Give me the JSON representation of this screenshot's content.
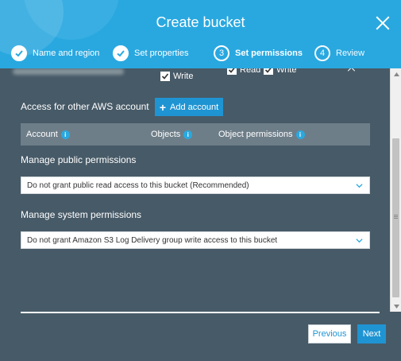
{
  "dialog": {
    "title": "Create bucket"
  },
  "steps": [
    {
      "number": "",
      "label": "Name and region",
      "state": "done"
    },
    {
      "number": "",
      "label": "Set properties",
      "state": "done"
    },
    {
      "number": "3",
      "label": "Set permissions",
      "state": "active"
    },
    {
      "number": "4",
      "label": "Review",
      "state": "future"
    }
  ],
  "permissions_row": {
    "write_label": "Write",
    "read_label": "Read",
    "write_label_2": "Write"
  },
  "other_account": {
    "label": "Access for other AWS account",
    "add_button_label": "Add account"
  },
  "table": {
    "columns": [
      "Account",
      "Objects",
      "Object permissions"
    ]
  },
  "public_permissions": {
    "label": "Manage public permissions",
    "selected": "Do not grant public read access to this bucket (Recommended)"
  },
  "system_permissions": {
    "label": "Manage system permissions",
    "selected": "Do not grant Amazon S3 Log Delivery group write access to this bucket"
  },
  "footer": {
    "previous_label": "Previous",
    "next_label": "Next"
  },
  "colors": {
    "header": "#29a8e0",
    "body": "#475a67",
    "accent": "#1f94d3"
  }
}
